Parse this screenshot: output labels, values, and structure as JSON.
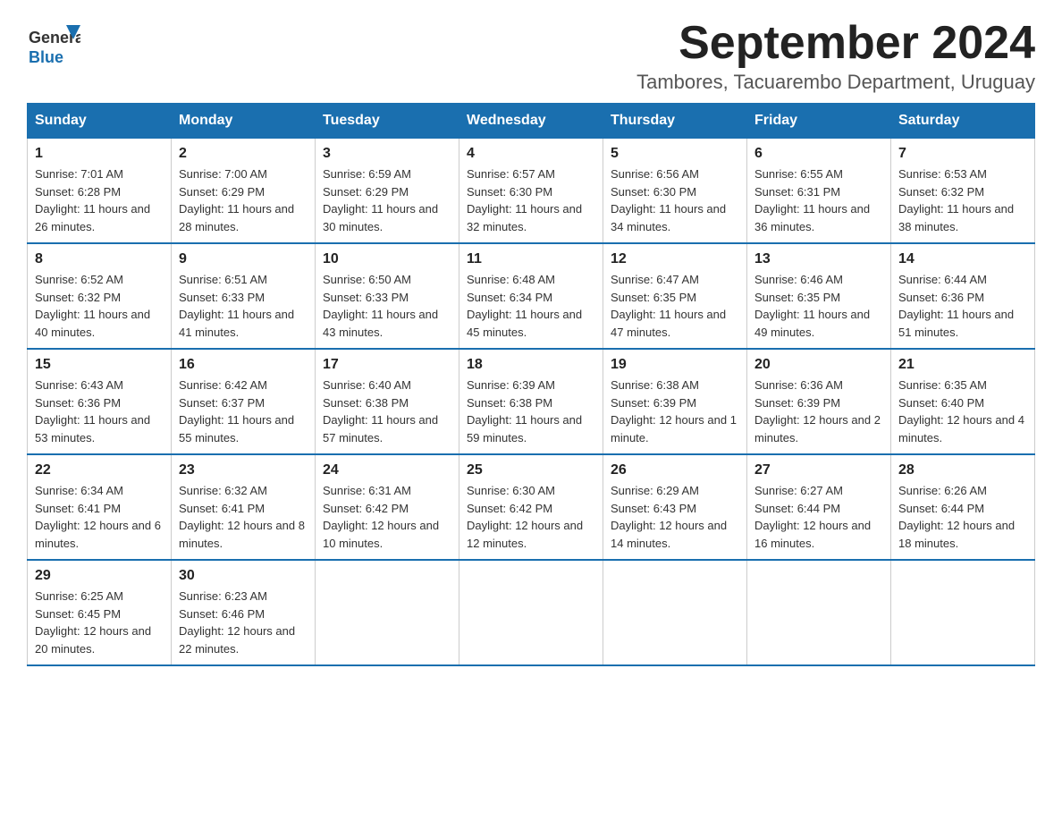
{
  "header": {
    "logo_text_general": "General",
    "logo_text_blue": "Blue",
    "month_title": "September 2024",
    "subtitle": "Tambores, Tacuarembo Department, Uruguay"
  },
  "days_of_week": [
    "Sunday",
    "Monday",
    "Tuesday",
    "Wednesday",
    "Thursday",
    "Friday",
    "Saturday"
  ],
  "weeks": [
    [
      {
        "day": "1",
        "sunrise": "7:01 AM",
        "sunset": "6:28 PM",
        "daylight": "11 hours and 26 minutes."
      },
      {
        "day": "2",
        "sunrise": "7:00 AM",
        "sunset": "6:29 PM",
        "daylight": "11 hours and 28 minutes."
      },
      {
        "day": "3",
        "sunrise": "6:59 AM",
        "sunset": "6:29 PM",
        "daylight": "11 hours and 30 minutes."
      },
      {
        "day": "4",
        "sunrise": "6:57 AM",
        "sunset": "6:30 PM",
        "daylight": "11 hours and 32 minutes."
      },
      {
        "day": "5",
        "sunrise": "6:56 AM",
        "sunset": "6:30 PM",
        "daylight": "11 hours and 34 minutes."
      },
      {
        "day": "6",
        "sunrise": "6:55 AM",
        "sunset": "6:31 PM",
        "daylight": "11 hours and 36 minutes."
      },
      {
        "day": "7",
        "sunrise": "6:53 AM",
        "sunset": "6:32 PM",
        "daylight": "11 hours and 38 minutes."
      }
    ],
    [
      {
        "day": "8",
        "sunrise": "6:52 AM",
        "sunset": "6:32 PM",
        "daylight": "11 hours and 40 minutes."
      },
      {
        "day": "9",
        "sunrise": "6:51 AM",
        "sunset": "6:33 PM",
        "daylight": "11 hours and 41 minutes."
      },
      {
        "day": "10",
        "sunrise": "6:50 AM",
        "sunset": "6:33 PM",
        "daylight": "11 hours and 43 minutes."
      },
      {
        "day": "11",
        "sunrise": "6:48 AM",
        "sunset": "6:34 PM",
        "daylight": "11 hours and 45 minutes."
      },
      {
        "day": "12",
        "sunrise": "6:47 AM",
        "sunset": "6:35 PM",
        "daylight": "11 hours and 47 minutes."
      },
      {
        "day": "13",
        "sunrise": "6:46 AM",
        "sunset": "6:35 PM",
        "daylight": "11 hours and 49 minutes."
      },
      {
        "day": "14",
        "sunrise": "6:44 AM",
        "sunset": "6:36 PM",
        "daylight": "11 hours and 51 minutes."
      }
    ],
    [
      {
        "day": "15",
        "sunrise": "6:43 AM",
        "sunset": "6:36 PM",
        "daylight": "11 hours and 53 minutes."
      },
      {
        "day": "16",
        "sunrise": "6:42 AM",
        "sunset": "6:37 PM",
        "daylight": "11 hours and 55 minutes."
      },
      {
        "day": "17",
        "sunrise": "6:40 AM",
        "sunset": "6:38 PM",
        "daylight": "11 hours and 57 minutes."
      },
      {
        "day": "18",
        "sunrise": "6:39 AM",
        "sunset": "6:38 PM",
        "daylight": "11 hours and 59 minutes."
      },
      {
        "day": "19",
        "sunrise": "6:38 AM",
        "sunset": "6:39 PM",
        "daylight": "12 hours and 1 minute."
      },
      {
        "day": "20",
        "sunrise": "6:36 AM",
        "sunset": "6:39 PM",
        "daylight": "12 hours and 2 minutes."
      },
      {
        "day": "21",
        "sunrise": "6:35 AM",
        "sunset": "6:40 PM",
        "daylight": "12 hours and 4 minutes."
      }
    ],
    [
      {
        "day": "22",
        "sunrise": "6:34 AM",
        "sunset": "6:41 PM",
        "daylight": "12 hours and 6 minutes."
      },
      {
        "day": "23",
        "sunrise": "6:32 AM",
        "sunset": "6:41 PM",
        "daylight": "12 hours and 8 minutes."
      },
      {
        "day": "24",
        "sunrise": "6:31 AM",
        "sunset": "6:42 PM",
        "daylight": "12 hours and 10 minutes."
      },
      {
        "day": "25",
        "sunrise": "6:30 AM",
        "sunset": "6:42 PM",
        "daylight": "12 hours and 12 minutes."
      },
      {
        "day": "26",
        "sunrise": "6:29 AM",
        "sunset": "6:43 PM",
        "daylight": "12 hours and 14 minutes."
      },
      {
        "day": "27",
        "sunrise": "6:27 AM",
        "sunset": "6:44 PM",
        "daylight": "12 hours and 16 minutes."
      },
      {
        "day": "28",
        "sunrise": "6:26 AM",
        "sunset": "6:44 PM",
        "daylight": "12 hours and 18 minutes."
      }
    ],
    [
      {
        "day": "29",
        "sunrise": "6:25 AM",
        "sunset": "6:45 PM",
        "daylight": "12 hours and 20 minutes."
      },
      {
        "day": "30",
        "sunrise": "6:23 AM",
        "sunset": "6:46 PM",
        "daylight": "12 hours and 22 minutes."
      },
      null,
      null,
      null,
      null,
      null
    ]
  ],
  "labels": {
    "sunrise": "Sunrise:",
    "sunset": "Sunset:",
    "daylight": "Daylight:"
  }
}
